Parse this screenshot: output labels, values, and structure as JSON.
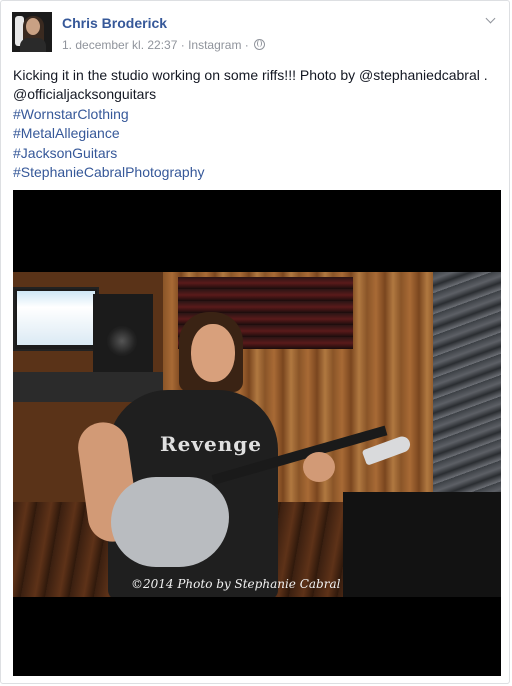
{
  "post": {
    "author": "Chris Broderick",
    "timestamp": "1. december kl. 22:37",
    "separator": "·",
    "source": "Instagram",
    "separator2": "·",
    "audience_icon": "globe-icon",
    "menu_icon": "chevron-down-icon",
    "text_line1": "Kicking it in the studio working on some riffs!!! Photo by @stephaniedcabral .",
    "text_line2": "@officialjacksonguitars",
    "hashtags": [
      "#WornstarClothing",
      "#MetalAllegiance",
      "#JacksonGuitars",
      "#StephanieCabralPhotography"
    ],
    "photo": {
      "shirt_print": "Revenge",
      "watermark": "©2014 Photo by Stephanie Cabral"
    }
  },
  "colors": {
    "link": "#365899",
    "meta": "#90949c",
    "text": "#141823"
  }
}
